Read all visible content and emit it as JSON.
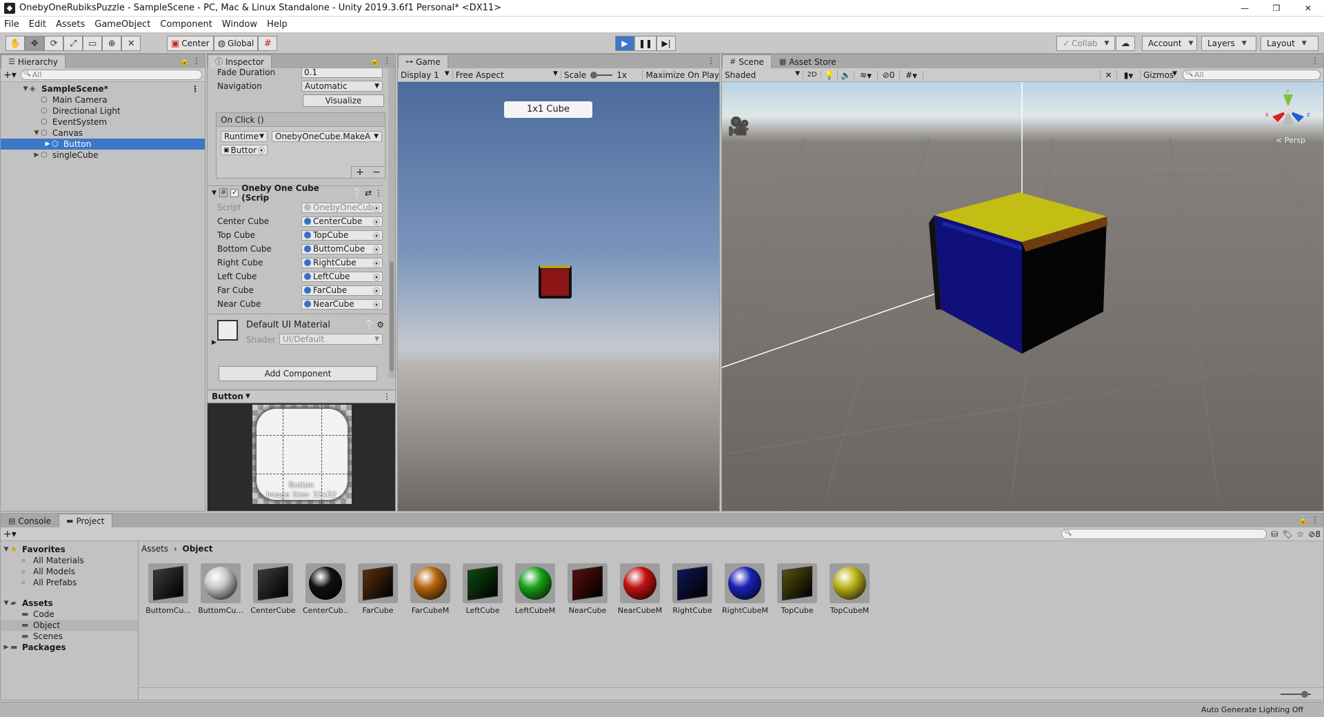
{
  "window": {
    "title": "OnebyOneRubiksPuzzle - SampleScene - PC, Mac & Linux Standalone - Unity 2019.3.6f1 Personal* <DX11>",
    "controls": [
      "—",
      "❐",
      "✕"
    ]
  },
  "menu": [
    "File",
    "Edit",
    "Assets",
    "GameObject",
    "Component",
    "Window",
    "Help"
  ],
  "toolbar": {
    "pivot": "Center",
    "space": "Global",
    "collab": "Collab",
    "account": "Account",
    "layers": "Layers",
    "layout": "Layout"
  },
  "hierarchy": {
    "tab": "Hierarchy",
    "search_placeholder": "All",
    "scene": "SampleScene*",
    "items": [
      {
        "label": "Main Camera"
      },
      {
        "label": "Directional Light"
      },
      {
        "label": "EventSystem"
      },
      {
        "label": "Canvas"
      },
      {
        "label": "Button"
      },
      {
        "label": "singleCube"
      }
    ]
  },
  "inspector": {
    "tab": "Inspector",
    "fade_duration_label": "Fade Duration",
    "fade_duration_value": "0.1",
    "navigation_label": "Navigation",
    "navigation_value": "Automatic",
    "visualize": "Visualize",
    "onclick_header": "On Click ()",
    "runtime": "Runtime",
    "method": "OnebyOneCube.MakeA",
    "target": "Buttor",
    "plus": "+",
    "minus": "−",
    "component_title": "Onebу One Cube (Scrip",
    "script_label": "Script",
    "script_value": "OnebyOneCub",
    "fields": [
      {
        "label": "Center Cube",
        "value": "CenterCube"
      },
      {
        "label": "Top Cube",
        "value": "TopCube"
      },
      {
        "label": "Bottom Cube",
        "value": "ButtomCube"
      },
      {
        "label": "Right Cube",
        "value": "RightCube"
      },
      {
        "label": "Left Cube",
        "value": "LeftCube"
      },
      {
        "label": "Far Cube",
        "value": "FarCube"
      },
      {
        "label": "Near Cube",
        "value": "NearCube"
      }
    ],
    "material_name": "Default UI Material",
    "shader_label": "Shader",
    "shader_value": "UI/Default",
    "add_component": "Add Component",
    "preview_title": "Button",
    "preview_name": "Button",
    "preview_size": "Image Size: 32x32"
  },
  "game": {
    "tab": "Game",
    "display": "Display 1",
    "aspect": "Free Aspect",
    "scale_label": "Scale",
    "scale_value": "1x",
    "maximize": "Maximize On Play",
    "button_label": "1x1 Cube"
  },
  "scene": {
    "tab": "Scene",
    "asset_store_tab": "Asset Store",
    "shading": "Shaded",
    "mode_2d": "2D",
    "hidden_count": "0",
    "gizmos": "Gizmos",
    "search_placeholder": "All",
    "persp": "Persp",
    "gizmo_axes": {
      "y": "y",
      "x": "x",
      "z": "z"
    }
  },
  "bottom": {
    "console_tab": "Console",
    "project_tab": "Project",
    "favorites": "Favorites",
    "favorites_items": [
      "All Materials",
      "All Models",
      "All Prefabs"
    ],
    "assets": "Assets",
    "assets_items": [
      "Code",
      "Object",
      "Scenes"
    ],
    "packages": "Packages",
    "breadcrumb_root": "Assets",
    "breadcrumb_current": "Object",
    "hidden_packages_count": "8",
    "assets_grid": [
      {
        "label": "ButtomCu...",
        "kind": "cube",
        "color": "#3a3a3a"
      },
      {
        "label": "ButtomCu...",
        "kind": "sphere",
        "color": "#c8c8c8"
      },
      {
        "label": "CenterCube",
        "kind": "cube",
        "color": "#3a3a3a"
      },
      {
        "label": "CenterCub...",
        "kind": "sphere",
        "color": "#111111"
      },
      {
        "label": "FarCube",
        "kind": "cube",
        "color": "#5a3010"
      },
      {
        "label": "FarCubeM",
        "kind": "sphere",
        "color": "#b8660f"
      },
      {
        "label": "LeftCube",
        "kind": "cube",
        "color": "#0e4a10"
      },
      {
        "label": "LeftCubeM",
        "kind": "sphere",
        "color": "#1aa31a"
      },
      {
        "label": "NearCube",
        "kind": "cube",
        "color": "#5a0e0e"
      },
      {
        "label": "NearCubeM",
        "kind": "sphere",
        "color": "#c21212"
      },
      {
        "label": "RightCube",
        "kind": "cube",
        "color": "#0e1656"
      },
      {
        "label": "RightCubeM",
        "kind": "sphere",
        "color": "#1a22b8"
      },
      {
        "label": "TopCube",
        "kind": "cube",
        "color": "#555210"
      },
      {
        "label": "TopCubeM",
        "kind": "sphere",
        "color": "#bdb51c"
      }
    ]
  },
  "status": "Auto Generate Lighting Off",
  "colors": {
    "selection": "#3d77c8",
    "panel": "#c2c2c2"
  }
}
